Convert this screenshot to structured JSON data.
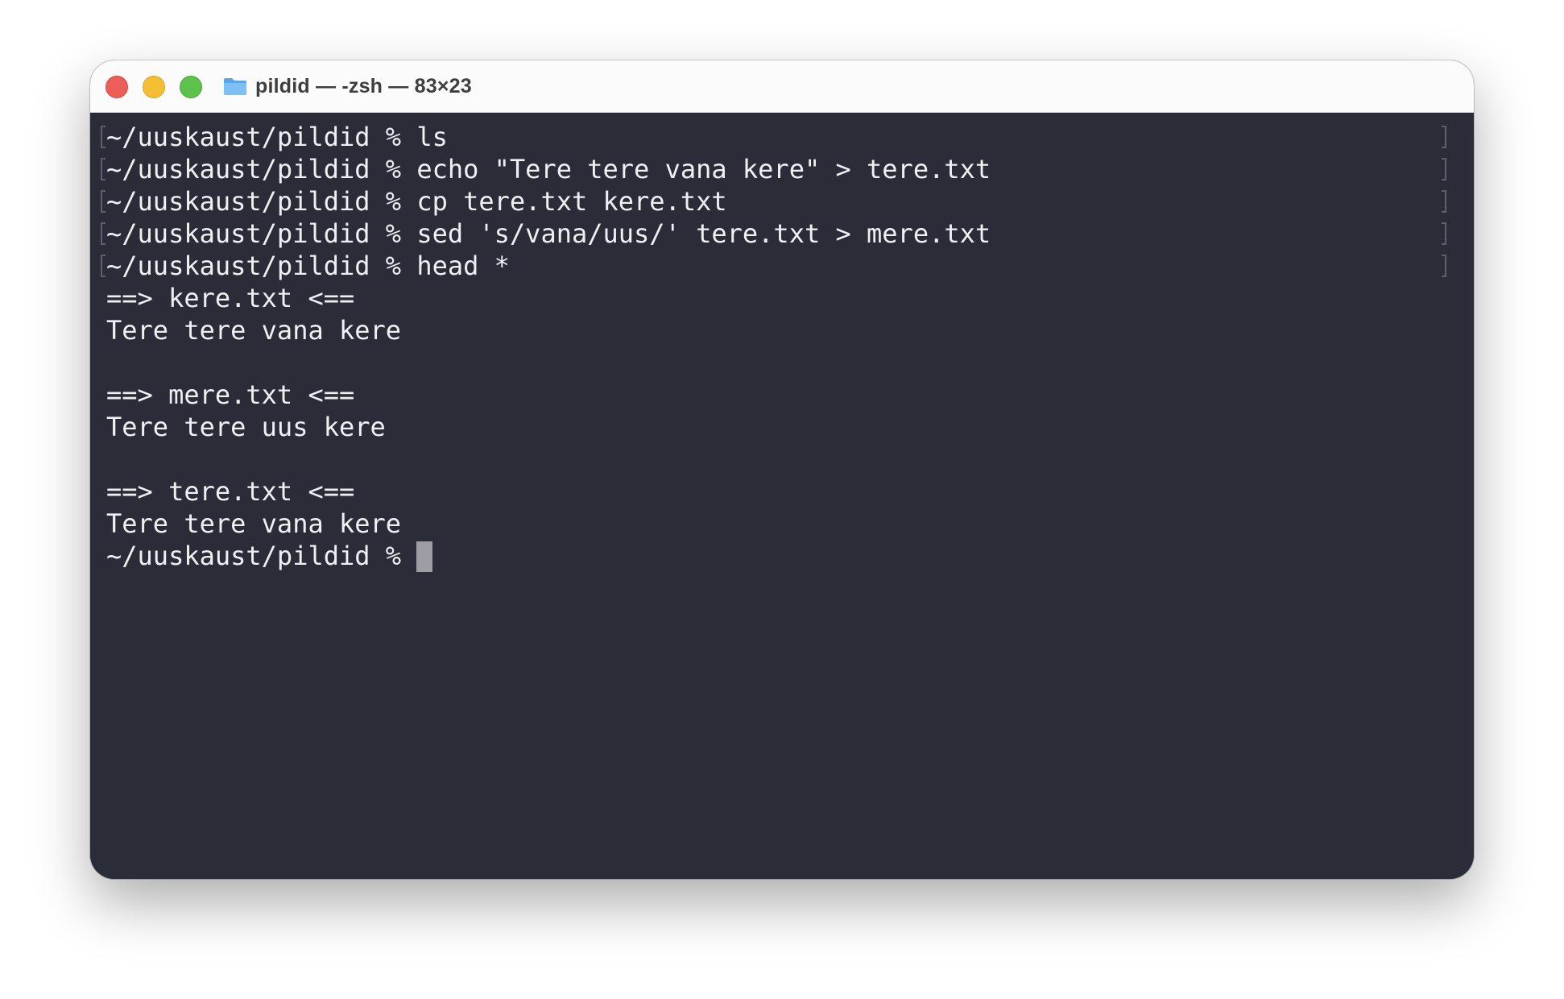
{
  "window": {
    "title": "pildid — -zsh — 83×23",
    "folder_icon": "folder-icon",
    "traffic_lights": {
      "close_color": "#ec5f58",
      "minimize_color": "#f4bf32",
      "maximize_color": "#5dc24c"
    }
  },
  "terminal": {
    "background": "#2a2d38",
    "foreground": "#eef0f2",
    "lines": [
      "~/uuskaust/pildid % ls",
      "~/uuskaust/pildid % echo \"Tere tere vana kere\" > tere.txt",
      "~/uuskaust/pildid % cp tere.txt kere.txt",
      "~/uuskaust/pildid % sed 's/vana/uus/' tere.txt > mere.txt",
      "~/uuskaust/pildid % head *",
      "==> kere.txt <==",
      "Tere tere vana kere",
      "==> mere.txt <==",
      "Tere tere uus kere",
      "==> tere.txt <==",
      "Tere tere vana kere"
    ],
    "prompt": "~/uuskaust/pildid % "
  }
}
